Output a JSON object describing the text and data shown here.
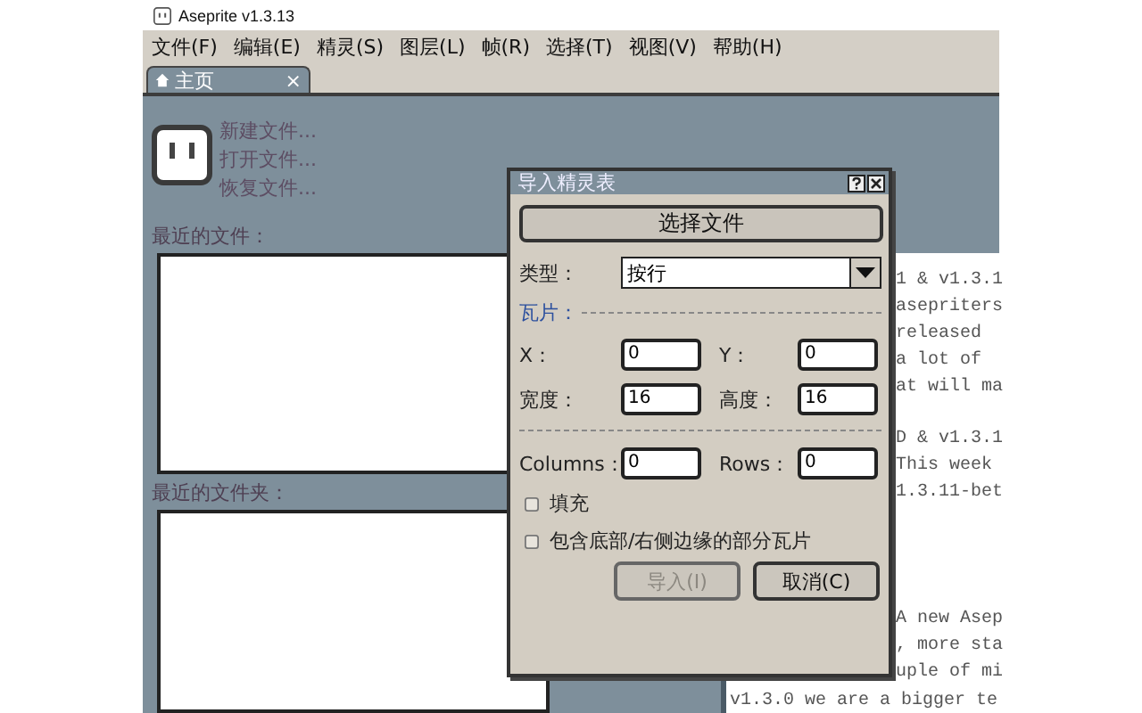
{
  "window": {
    "title": "Aseprite v1.3.13"
  },
  "menu": [
    "文件(F)",
    "编辑(E)",
    "精灵(S)",
    "图层(L)",
    "帧(R)",
    "选择(T)",
    "视图(V)",
    "帮助(H)"
  ],
  "tabs": [
    {
      "label": "主页",
      "selected": true,
      "close": "×"
    }
  ],
  "home": {
    "actions": [
      "新建文件...",
      "打开文件...",
      "恢复文件..."
    ],
    "recent_files_label": "最近的文件：",
    "recent_folders_label": "最近的文件夹："
  },
  "news": {
    "paragraphs": [
      [
        "1 & v1.3.1",
        "asepriters",
        "released",
        "a lot of",
        "at will ma"
      ],
      [
        "D & v1.3.1",
        "This week",
        "1.3.11-bet"
      ],
      [
        "A new Asep",
        ", more sta",
        "uple of mi"
      ]
    ],
    "last_line": "v1.3.0 we are a bigger te"
  },
  "dialog": {
    "title": "导入精灵表",
    "select_file": "选择文件",
    "type_label": "类型：",
    "type_value": "按行",
    "section": "瓦片：",
    "rows": [
      [
        {
          "label": "X：",
          "value": "0"
        },
        {
          "label": "Y：",
          "value": "0"
        }
      ],
      [
        {
          "label": "宽度：",
          "value": "16"
        },
        {
          "label": "高度：",
          "value": "16"
        }
      ],
      [
        {
          "label": "Columns：",
          "value": "0"
        },
        {
          "label": "Rows：",
          "value": "0"
        }
      ]
    ],
    "checkboxes": [
      {
        "label": "填充",
        "checked": false
      },
      {
        "label": "包含底部/右侧边缘的部分瓦片",
        "checked": false
      }
    ],
    "buttons": [
      {
        "label": "导入(I)",
        "disabled": true
      },
      {
        "label": "取消(C)",
        "disabled": false
      }
    ]
  }
}
